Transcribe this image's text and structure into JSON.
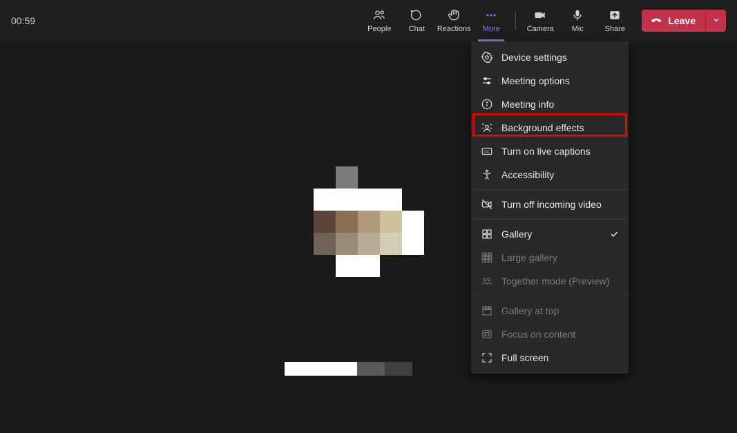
{
  "timer": "00:59",
  "toolbar": {
    "people": "People",
    "chat": "Chat",
    "reactions": "Reactions",
    "more": "More",
    "camera": "Camera",
    "mic": "Mic",
    "share": "Share",
    "leave": "Leave"
  },
  "more_menu": {
    "device_settings": "Device settings",
    "meeting_options": "Meeting options",
    "meeting_info": "Meeting info",
    "background_effects": "Background effects",
    "live_captions": "Turn on live captions",
    "accessibility": "Accessibility",
    "turn_off_incoming": "Turn off incoming video",
    "gallery": "Gallery",
    "large_gallery": "Large gallery",
    "together_mode": "Together mode (Preview)",
    "gallery_at_top": "Gallery at top",
    "focus_on_content": "Focus on content",
    "full_screen": "Full screen"
  }
}
